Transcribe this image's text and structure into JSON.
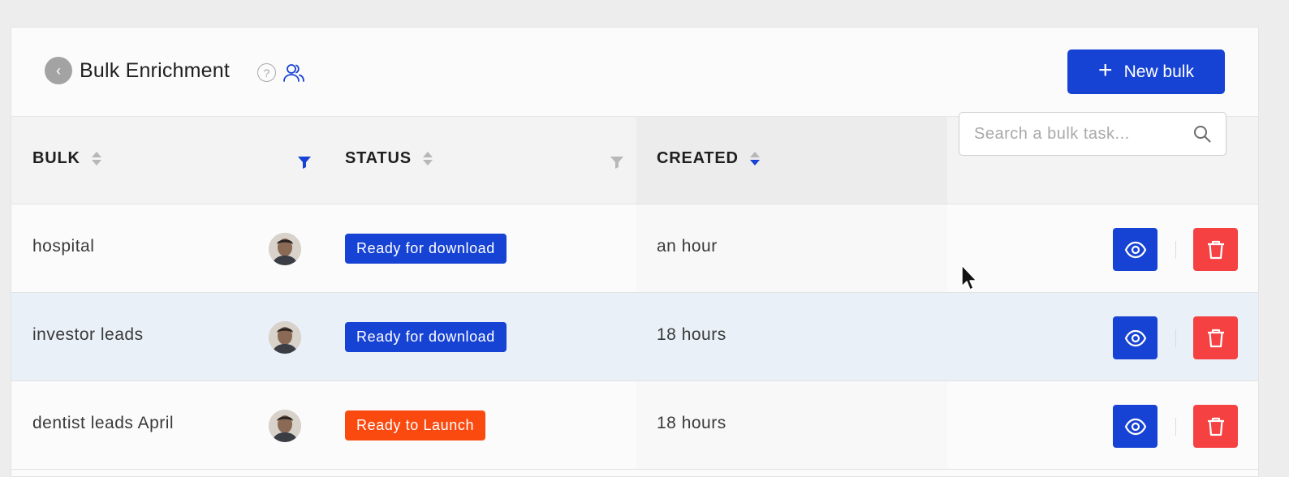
{
  "header": {
    "back_glyph": "‹",
    "title": "Bulk Enrichment",
    "help_glyph": "?",
    "new_bulk_label": "New bulk",
    "plus_glyph": "+"
  },
  "table": {
    "columns": [
      {
        "label": "BULK",
        "sort": "none",
        "filter_active": true
      },
      {
        "label": "STATUS",
        "sort": "none",
        "filter_active": false
      },
      {
        "label": "CREATED",
        "sort": "descending"
      }
    ],
    "search_placeholder": "Search a bulk task...",
    "rows": [
      {
        "name": "hospital",
        "status": "Ready for download",
        "status_color": "#1743d4",
        "created": "an hour",
        "highlighted": false
      },
      {
        "name": "investor leads",
        "status": "Ready for download",
        "status_color": "#1743d4",
        "created": "18 hours",
        "highlighted": true
      },
      {
        "name": "dentist leads April",
        "status": "Ready to Launch",
        "status_color": "#fa4a0f",
        "created": "18 hours",
        "highlighted": false
      }
    ]
  },
  "icons": {
    "back": "chevron-left-icon",
    "help": "question-circle-icon",
    "users": "users-icon",
    "search": "search-icon",
    "view": "eye-icon",
    "delete": "trash-icon",
    "filter": "funnel-icon"
  },
  "colors": {
    "primary": "#1743d4",
    "danger": "#f54141",
    "warning": "#fa4a0f",
    "row_highlight": "#e9f0f8"
  }
}
